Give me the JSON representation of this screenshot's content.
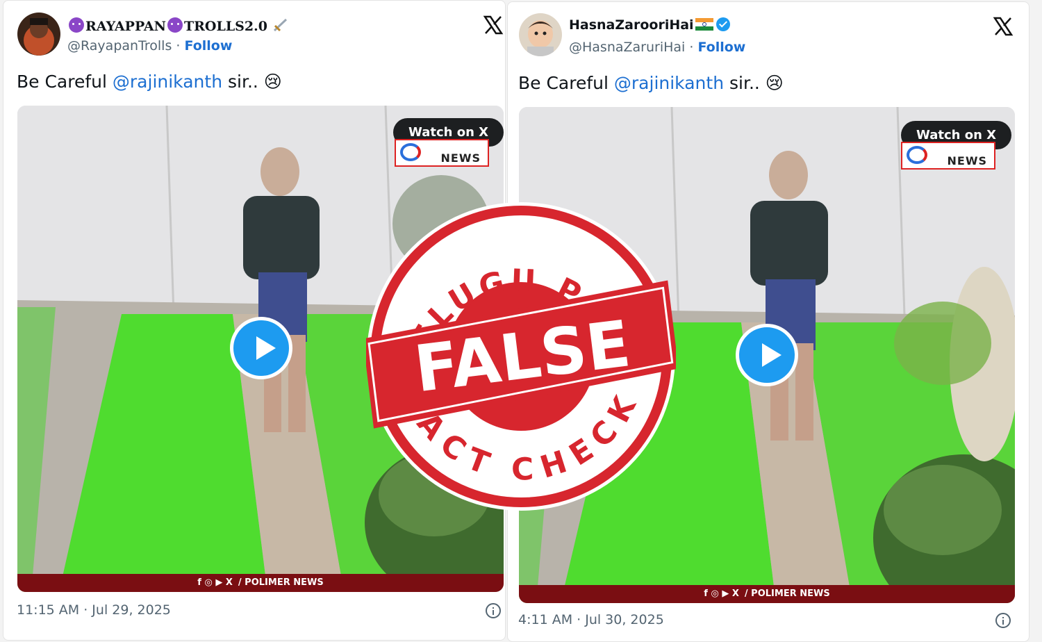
{
  "tweets": [
    {
      "display_name": "RAYAPPAN",
      "display_name_2": "TROLLS2.0",
      "handle": "@RayapanTrolls",
      "separator": " · ",
      "follow_label": "Follow",
      "text_before": "Be Careful ",
      "mention": "@rajinikanth",
      "text_after": " sir.. ",
      "emoji": "😢",
      "watch_label": "Watch on X",
      "news_logo_text": "NEWS",
      "footer_text": "/ POLIMER NEWS",
      "footer_icons": "f ◎ ▶ X",
      "timestamp": "11:15 AM · Jul 29, 2025"
    },
    {
      "display_name": "HasnaZarooriHai",
      "handle": "@HasnaZaruriHai",
      "separator": " · ",
      "follow_label": "Follow",
      "text_before": "Be Careful ",
      "mention": "@rajinikanth",
      "text_after": " sir.. ",
      "emoji": "😢",
      "watch_label": "Watch on X",
      "news_logo_text": "NEWS",
      "footer_text": "/ POLIMER NEWS",
      "footer_icons": "f ◎ ▶ X",
      "timestamp": "4:11 AM · Jul 30, 2025"
    }
  ],
  "stamp": {
    "top_text": "TELUGU POST",
    "main_text": "FALSE",
    "bottom_text": "FACT CHECK",
    "color": "#d7262e"
  },
  "colors": {
    "link_blue": "#1d6fd1",
    "play_blue": "#1d9bf0",
    "footer_red": "#7a0e12"
  }
}
